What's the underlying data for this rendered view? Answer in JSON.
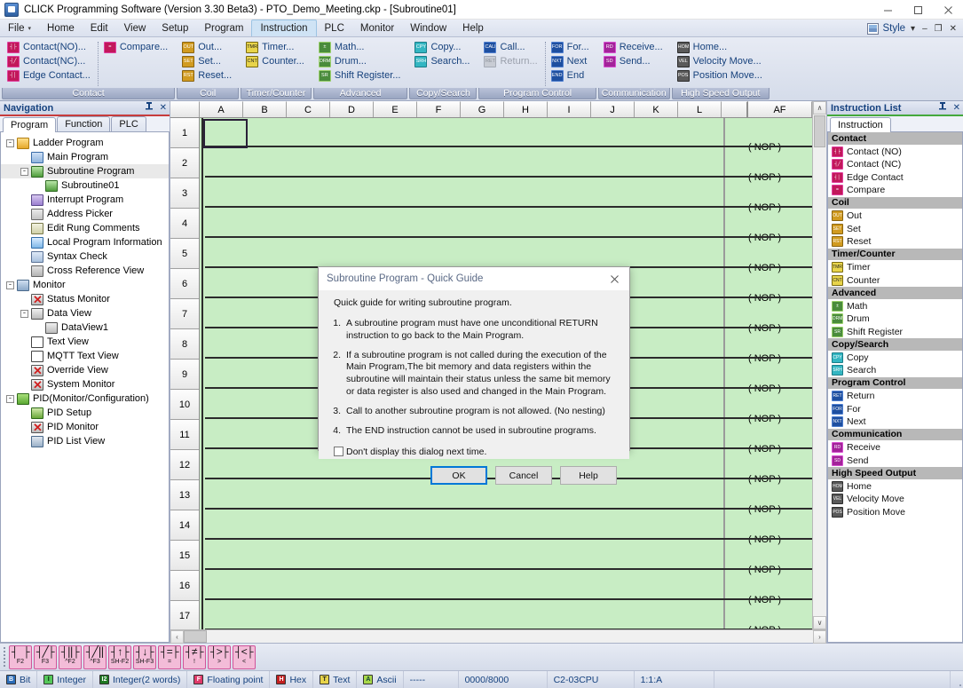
{
  "window": {
    "title": "CLICK Programming Software (Version 3.30 Beta3) - PTO_Demo_Meeting.ckp - [Subroutine01]",
    "app_icon": "click-app-icon",
    "minimize": "–",
    "maximize": "□",
    "close": "✕"
  },
  "menubar": {
    "items": [
      {
        "label": "File",
        "has_caret": true,
        "active": false
      },
      {
        "label": "Home",
        "active": false
      },
      {
        "label": "Edit",
        "active": false
      },
      {
        "label": "View",
        "active": false
      },
      {
        "label": "Setup",
        "active": false
      },
      {
        "label": "Program",
        "active": false
      },
      {
        "label": "Instruction",
        "active": true
      },
      {
        "label": "PLC",
        "active": false
      },
      {
        "label": "Monitor",
        "active": false
      },
      {
        "label": "Window",
        "active": false
      },
      {
        "label": "Help",
        "active": false
      }
    ],
    "style_label": "Style",
    "style_caret": "▾",
    "doc_minimize": "–",
    "doc_restore": "❐",
    "doc_close": "✕"
  },
  "ribbon": {
    "groups": [
      {
        "name": "Contact",
        "columns": [
          [
            {
              "label": "Contact(NO)...",
              "icon": "contact-no-icon",
              "color": "pink",
              "glyph": "┤├",
              "disabled": false
            },
            {
              "label": "Contact(NC)...",
              "icon": "contact-nc-icon",
              "color": "pink",
              "glyph": "┤╱",
              "disabled": false
            },
            {
              "label": "Edge Contact...",
              "icon": "edge-contact-icon",
              "color": "pink",
              "glyph": "┤│",
              "disabled": false
            }
          ],
          [
            {
              "label": "Compare...",
              "icon": "compare-icon",
              "color": "pink",
              "glyph": "=",
              "disabled": false
            }
          ]
        ]
      },
      {
        "name": "Coil",
        "columns": [
          [
            {
              "label": "Out...",
              "icon": "out-coil-icon",
              "color": "gold",
              "glyph": "OUT",
              "disabled": false
            },
            {
              "label": "Set...",
              "icon": "set-coil-icon",
              "color": "gold",
              "glyph": "SET",
              "disabled": false
            },
            {
              "label": "Reset...",
              "icon": "reset-coil-icon",
              "color": "gold",
              "glyph": "RST",
              "disabled": false
            }
          ]
        ]
      },
      {
        "name": "Timer/Counter",
        "columns": [
          [
            {
              "label": "Timer...",
              "icon": "timer-icon",
              "color": "yel",
              "glyph": "TMR",
              "disabled": false
            },
            {
              "label": "Counter...",
              "icon": "counter-icon",
              "color": "yel",
              "glyph": "CNT",
              "disabled": false
            }
          ]
        ]
      },
      {
        "name": "Advanced",
        "columns": [
          [
            {
              "label": "Math...",
              "icon": "math-icon",
              "color": "grn",
              "glyph": "±",
              "disabled": false
            },
            {
              "label": "Drum...",
              "icon": "drum-icon",
              "color": "grn",
              "glyph": "DRM",
              "disabled": false
            },
            {
              "label": "Shift Register...",
              "icon": "shift-register-icon",
              "color": "grn",
              "glyph": "SR",
              "disabled": false
            }
          ]
        ]
      },
      {
        "name": "Copy/Search",
        "columns": [
          [
            {
              "label": "Copy...",
              "icon": "copy-icon",
              "color": "cyan",
              "glyph": "CPY",
              "disabled": false
            },
            {
              "label": "Search...",
              "icon": "search-icon",
              "color": "cyan",
              "glyph": "SRH",
              "disabled": false
            }
          ]
        ]
      },
      {
        "name": "Program Control",
        "columns": [
          [
            {
              "label": "Call...",
              "icon": "call-icon",
              "color": "blue",
              "glyph": "CALL",
              "disabled": false
            },
            {
              "label": "Return...",
              "icon": "return-icon",
              "color": "dis",
              "glyph": "RET",
              "disabled": true
            }
          ],
          [
            {
              "label": "For...",
              "icon": "for-icon",
              "color": "blue",
              "glyph": "FOR",
              "disabled": false
            },
            {
              "label": "Next",
              "icon": "next-icon",
              "color": "blue",
              "glyph": "NXT",
              "disabled": false
            },
            {
              "label": "End",
              "icon": "end-icon",
              "color": "blue",
              "glyph": "END",
              "disabled": false
            }
          ]
        ]
      },
      {
        "name": "Communication",
        "columns": [
          [
            {
              "label": "Receive...",
              "icon": "receive-icon",
              "color": "mag",
              "glyph": "RD",
              "disabled": false
            },
            {
              "label": "Send...",
              "icon": "send-icon",
              "color": "mag",
              "glyph": "SD",
              "disabled": false
            }
          ]
        ]
      },
      {
        "name": "High Speed Output",
        "columns": [
          [
            {
              "label": "Home...",
              "icon": "home-icon",
              "color": "gray",
              "glyph": "HOM",
              "disabled": false
            },
            {
              "label": "Velocity Move...",
              "icon": "velocity-move-icon",
              "color": "gray",
              "glyph": "VEL",
              "disabled": false
            },
            {
              "label": "Position Move...",
              "icon": "position-move-icon",
              "color": "gray",
              "glyph": "POS",
              "disabled": false
            }
          ]
        ]
      }
    ]
  },
  "navigation": {
    "title": "Navigation",
    "pin": "➤",
    "close": "✕",
    "tabs": [
      {
        "label": "Program",
        "active": true
      },
      {
        "label": "Function",
        "active": false
      },
      {
        "label": "PLC",
        "active": false
      }
    ],
    "tree": [
      {
        "label": "Ladder Program",
        "indent": 0,
        "expander": "-",
        "icon": "folder",
        "iconname": "folder-icon",
        "selected": false
      },
      {
        "label": "Main Program",
        "indent": 1,
        "expander": "",
        "icon": "ladder",
        "iconname": "main-program-icon",
        "selected": false
      },
      {
        "label": "Subroutine Program",
        "indent": 1,
        "expander": "-",
        "icon": "sub",
        "iconname": "subroutine-program-icon",
        "selected": true
      },
      {
        "label": "Subroutine01",
        "indent": 2,
        "expander": "",
        "icon": "sub",
        "iconname": "subroutine01-icon",
        "selected": false
      },
      {
        "label": "Interrupt Program",
        "indent": 1,
        "expander": "",
        "icon": "intr",
        "iconname": "interrupt-program-icon",
        "selected": false
      },
      {
        "label": "Address Picker",
        "indent": 1,
        "expander": "",
        "icon": "addr",
        "iconname": "address-picker-icon",
        "selected": false
      },
      {
        "label": "Edit Rung Comments",
        "indent": 1,
        "expander": "",
        "icon": "edit",
        "iconname": "edit-rung-comments-icon",
        "selected": false
      },
      {
        "label": "Local Program Information",
        "indent": 1,
        "expander": "",
        "icon": "info",
        "iconname": "local-program-information-icon",
        "selected": false
      },
      {
        "label": "Syntax Check",
        "indent": 1,
        "expander": "",
        "icon": "synt",
        "iconname": "syntax-check-icon",
        "selected": false
      },
      {
        "label": "Cross Reference View",
        "indent": 1,
        "expander": "",
        "icon": "xref",
        "iconname": "cross-reference-view-icon",
        "selected": false
      },
      {
        "label": "Monitor",
        "indent": 0,
        "expander": "-",
        "icon": "mon",
        "iconname": "monitor-icon",
        "selected": false
      },
      {
        "label": "Status Monitor",
        "indent": 1,
        "expander": "",
        "icon": "dview",
        "iconname": "status-monitor-icon",
        "selected": false,
        "cross": true
      },
      {
        "label": "Data View",
        "indent": 1,
        "expander": "-",
        "icon": "dview",
        "iconname": "data-view-icon",
        "selected": false
      },
      {
        "label": "DataView1",
        "indent": 2,
        "expander": "",
        "icon": "dview",
        "iconname": "dataview1-icon",
        "selected": false
      },
      {
        "label": "Text View",
        "indent": 1,
        "expander": "",
        "icon": "txt",
        "iconname": "text-view-icon",
        "selected": false
      },
      {
        "label": "MQTT Text View",
        "indent": 1,
        "expander": "",
        "icon": "txt",
        "iconname": "mqtt-text-view-icon",
        "selected": false
      },
      {
        "label": "Override View",
        "indent": 1,
        "expander": "",
        "icon": "dview",
        "iconname": "override-view-icon",
        "selected": false,
        "cross": true
      },
      {
        "label": "System Monitor",
        "indent": 1,
        "expander": "",
        "icon": "dview",
        "iconname": "system-monitor-icon",
        "selected": false,
        "cross": true
      },
      {
        "label": "PID(Monitor/Configuration)",
        "indent": 0,
        "expander": "-",
        "icon": "pid",
        "iconname": "pid-icon",
        "selected": false
      },
      {
        "label": "PID Setup",
        "indent": 1,
        "expander": "",
        "icon": "pidset",
        "iconname": "pid-setup-icon",
        "selected": false
      },
      {
        "label": "PID Monitor",
        "indent": 1,
        "expander": "",
        "icon": "dview",
        "iconname": "pid-monitor-icon",
        "selected": false,
        "cross": true
      },
      {
        "label": "PID List View",
        "indent": 1,
        "expander": "",
        "icon": "pidls",
        "iconname": "pid-list-view-icon",
        "selected": false
      }
    ]
  },
  "ladder": {
    "columns": [
      "A",
      "B",
      "C",
      "D",
      "E",
      "F",
      "G",
      "H",
      "I",
      "J",
      "K",
      "L"
    ],
    "end_column": "AF",
    "rows": [
      1,
      2,
      3,
      4,
      5,
      6,
      7,
      8,
      9,
      10,
      11,
      12,
      13,
      14,
      15,
      16,
      17
    ],
    "rung_instruction": "( NOP )",
    "cursor_position": "1:1:A",
    "scroll_up": "∧",
    "scroll_down": "∨",
    "scroll_left": "‹",
    "scroll_right": "›"
  },
  "instruction_list": {
    "title": "Instruction List",
    "pin": "➤",
    "close": "✕",
    "tab": "Instruction",
    "groups": [
      {
        "name": "Contact",
        "items": [
          {
            "label": "Contact (NO)",
            "icon": "contact-no-icon",
            "color": "pink",
            "glyph": "┤├"
          },
          {
            "label": "Contact (NC)",
            "icon": "contact-nc-icon",
            "color": "pink",
            "glyph": "┤╱"
          },
          {
            "label": "Edge Contact",
            "icon": "edge-contact-icon",
            "color": "pink",
            "glyph": "┤│"
          },
          {
            "label": "Compare",
            "icon": "compare-icon",
            "color": "pink",
            "glyph": "="
          }
        ]
      },
      {
        "name": "Coil",
        "items": [
          {
            "label": "Out",
            "icon": "out-coil-icon",
            "color": "gold",
            "glyph": "OUT"
          },
          {
            "label": "Set",
            "icon": "set-coil-icon",
            "color": "gold",
            "glyph": "SET"
          },
          {
            "label": "Reset",
            "icon": "reset-coil-icon",
            "color": "gold",
            "glyph": "RST"
          }
        ]
      },
      {
        "name": "Timer/Counter",
        "items": [
          {
            "label": "Timer",
            "icon": "timer-icon",
            "color": "yel",
            "glyph": "TMR"
          },
          {
            "label": "Counter",
            "icon": "counter-icon",
            "color": "yel",
            "glyph": "CNT"
          }
        ]
      },
      {
        "name": "Advanced",
        "items": [
          {
            "label": "Math",
            "icon": "math-icon",
            "color": "grn",
            "glyph": "±"
          },
          {
            "label": "Drum",
            "icon": "drum-icon",
            "color": "grn",
            "glyph": "DRM"
          },
          {
            "label": "Shift Register",
            "icon": "shift-register-icon",
            "color": "grn",
            "glyph": "SR"
          }
        ]
      },
      {
        "name": "Copy/Search",
        "items": [
          {
            "label": "Copy",
            "icon": "copy-icon",
            "color": "cyan",
            "glyph": "CPY"
          },
          {
            "label": "Search",
            "icon": "search-icon",
            "color": "cyan",
            "glyph": "SRH"
          }
        ]
      },
      {
        "name": "Program Control",
        "items": [
          {
            "label": "Return",
            "icon": "return-icon",
            "color": "blue",
            "glyph": "RET"
          },
          {
            "label": "For",
            "icon": "for-icon",
            "color": "blue",
            "glyph": "FOR"
          },
          {
            "label": "Next",
            "icon": "next-icon",
            "color": "blue",
            "glyph": "NXT"
          }
        ]
      },
      {
        "name": "Communication",
        "items": [
          {
            "label": "Receive",
            "icon": "receive-icon",
            "color": "mag",
            "glyph": "RD"
          },
          {
            "label": "Send",
            "icon": "send-icon",
            "color": "mag",
            "glyph": "SD"
          }
        ]
      },
      {
        "name": "High Speed Output",
        "items": [
          {
            "label": "Home",
            "icon": "home-icon",
            "color": "gray",
            "glyph": "HOM"
          },
          {
            "label": "Velocity Move",
            "icon": "velocity-move-icon",
            "color": "gray",
            "glyph": "VEL"
          },
          {
            "label": "Position Move",
            "icon": "position-move-icon",
            "color": "gray",
            "glyph": "POS"
          }
        ]
      }
    ]
  },
  "dialog": {
    "title": "Subroutine Program - Quick Guide",
    "close": "✕",
    "intro": "Quick guide for writing subroutine program.",
    "items": [
      {
        "num": "1.",
        "text": "A subroutine program must have one unconditional RETURN instruction to go back to the Main Program."
      },
      {
        "num": "2.",
        "text": "If a subroutine program is not called during the execution of the Main Program,The bit memory and data registers within the subroutine will maintain their status unless the same bit memory or data register is also used and changed in the Main Program."
      },
      {
        "num": "3.",
        "text": "Call to another subroutine program is not allowed. (No nesting)"
      },
      {
        "num": "4.",
        "text": "The END instruction cannot be used in subroutine programs."
      }
    ],
    "checkbox_label": "Don't display this dialog next time.",
    "checkbox_checked": false,
    "buttons": [
      {
        "label": "OK",
        "primary": true
      },
      {
        "label": "Cancel",
        "primary": false
      },
      {
        "label": "Help",
        "primary": false
      }
    ]
  },
  "bottom_toolbar": {
    "buttons": [
      {
        "symbol": "┤ ├",
        "key": "F2",
        "name": "contact-no-f2"
      },
      {
        "symbol": "┤╱├",
        "key": "F3",
        "name": "contact-nc-f3"
      },
      {
        "symbol": "┤‖├",
        "key": "^F2",
        "name": "edge-rising-ctrl-f2"
      },
      {
        "symbol": "┤╱‖",
        "key": "^F3",
        "name": "edge-falling-ctrl-f3"
      },
      {
        "symbol": "┤↑├",
        "key": "SH-F2",
        "name": "edge-up-shift-f2"
      },
      {
        "symbol": "┤↓├",
        "key": "SH-F3",
        "name": "edge-down-shift-f3"
      },
      {
        "symbol": "┤=├",
        "key": "=",
        "name": "compare-equal"
      },
      {
        "symbol": "┤≠├",
        "key": "!",
        "name": "compare-not-equal"
      },
      {
        "symbol": "┤>├",
        "key": ">",
        "name": "compare-greater"
      },
      {
        "symbol": "┤<├",
        "key": "<",
        "name": "compare-less"
      }
    ]
  },
  "statusbar": {
    "cells": [
      {
        "label": "Bit",
        "icon": "bit",
        "glyph": "B",
        "name": "status-bit"
      },
      {
        "label": "Integer",
        "icon": "int",
        "glyph": "I",
        "name": "status-integer"
      },
      {
        "label": "Integer(2 words)",
        "icon": "int2",
        "glyph": "I2",
        "name": "status-integer2"
      },
      {
        "label": "Floating point",
        "icon": "flt",
        "glyph": "F",
        "name": "status-floating-point"
      },
      {
        "label": "Hex",
        "icon": "hex",
        "glyph": "H",
        "name": "status-hex"
      },
      {
        "label": "Text",
        "icon": "txt",
        "glyph": "T",
        "name": "status-text"
      },
      {
        "label": "Ascii",
        "icon": "asc",
        "glyph": "A",
        "name": "status-ascii"
      }
    ],
    "dashes": "-----",
    "memory_usage": "0000/8000",
    "cpu_model": "C2-03CPU",
    "cursor_location": "1:1:A"
  }
}
